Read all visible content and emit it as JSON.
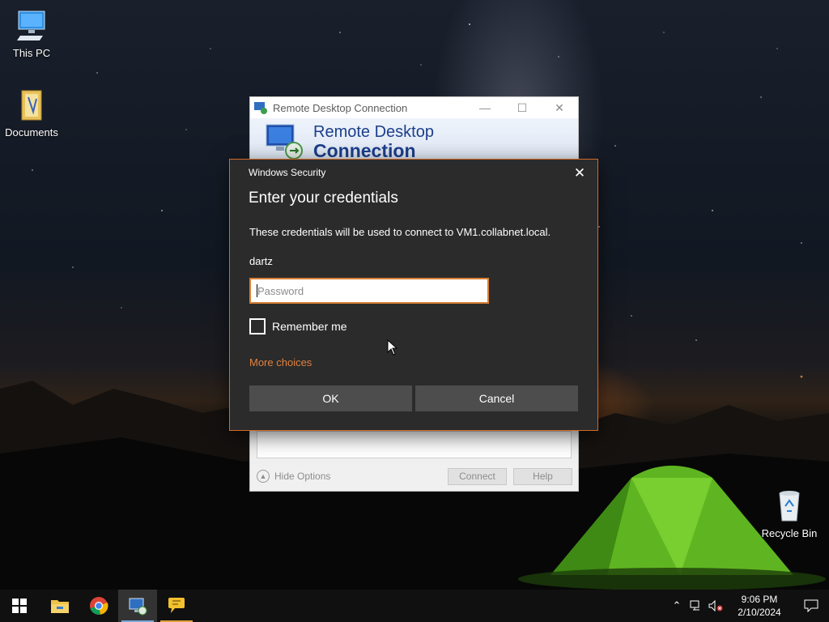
{
  "desktop": {
    "icons": [
      {
        "label": "This PC",
        "icon": "computer-icon"
      },
      {
        "label": "Documents",
        "icon": "folder-icon"
      },
      {
        "label": "Recycle Bin",
        "icon": "recycle-bin-icon"
      }
    ]
  },
  "rdc_window": {
    "title": "Remote Desktop Connection",
    "banner_line1": "Remote Desktop",
    "banner_line2": "Connection",
    "hide_options_label": "Hide Options",
    "connect_label": "Connect",
    "help_label": "Help"
  },
  "security_dialog": {
    "caption": "Windows Security",
    "heading": "Enter your credentials",
    "description": "These credentials will be used to connect to VM1.collabnet.local.",
    "username": "dartz",
    "password_placeholder": "Password",
    "password_value": "",
    "remember_label": "Remember me",
    "remember_checked": false,
    "more_choices_label": "More choices",
    "ok_label": "OK",
    "cancel_label": "Cancel",
    "accent_color": "#d06a28"
  },
  "taskbar": {
    "apps": [
      {
        "name": "file-explorer",
        "icon": "folder-icon"
      },
      {
        "name": "chrome",
        "icon": "chrome-icon"
      },
      {
        "name": "remote-desktop",
        "icon": "remote-desktop-icon",
        "active": true
      },
      {
        "name": "chat",
        "icon": "chat-icon"
      }
    ],
    "clock_time": "9:06 PM",
    "clock_date": "2/10/2024"
  }
}
